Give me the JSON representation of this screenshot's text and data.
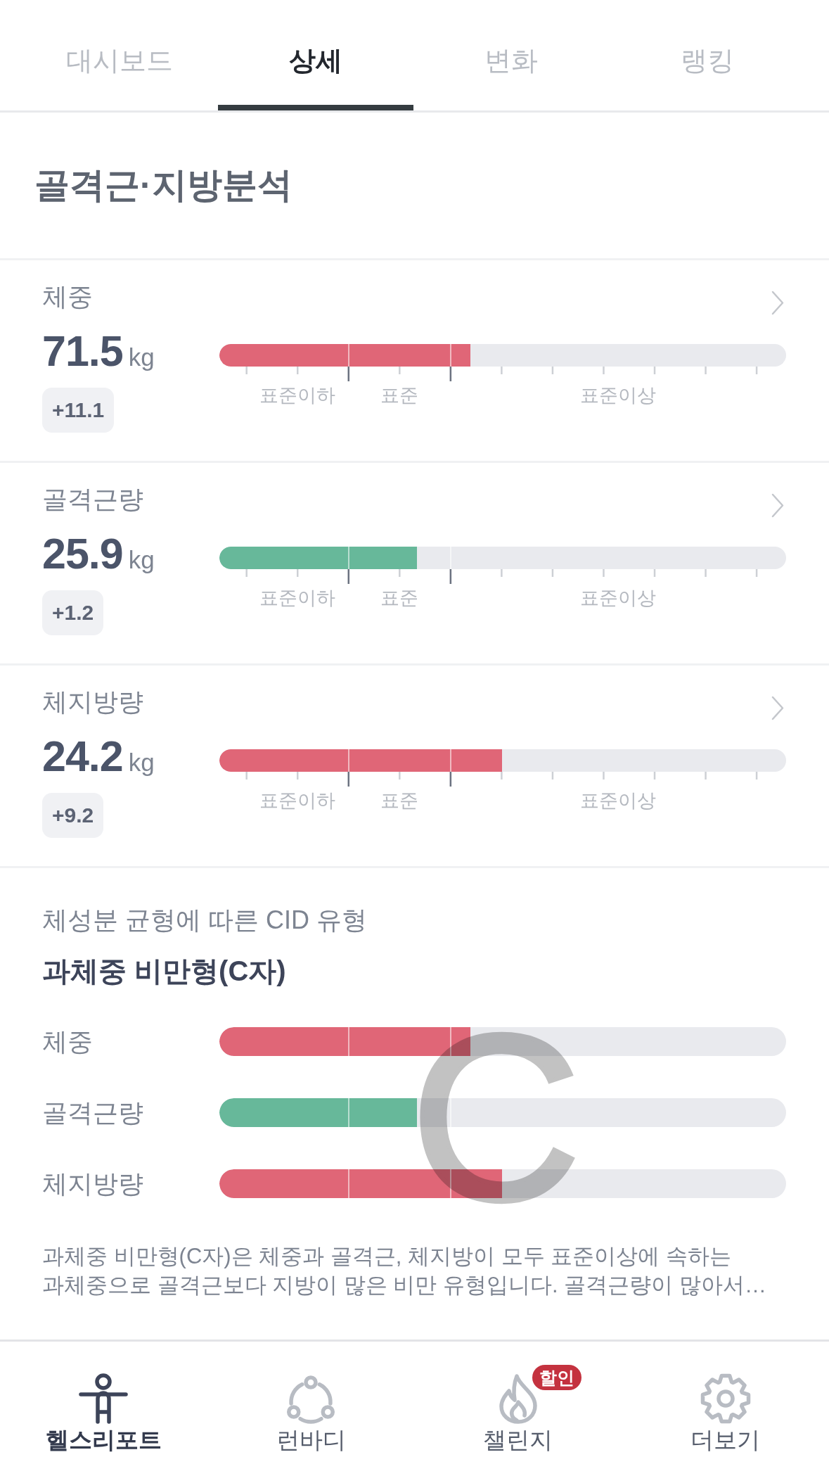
{
  "tabs": [
    {
      "label": "대시보드",
      "selected": false
    },
    {
      "label": "상세",
      "selected": true
    },
    {
      "label": "변화",
      "selected": false
    },
    {
      "label": "랭킹",
      "selected": false
    }
  ],
  "section_title": "골격근·지방분석",
  "metrics": [
    {
      "name": "체중",
      "value": "71.5",
      "unit": "kg",
      "change": "+11.1",
      "level": 0.443,
      "color": "#e06677",
      "range_labels": [
        "표준이하",
        "표준",
        "표준이상"
      ]
    },
    {
      "name": "골격근량",
      "value": "25.9",
      "unit": "kg",
      "change": "+1.2",
      "level": 0.349,
      "color": "#67b89a",
      "range_labels": [
        "표준이하",
        "표준",
        "표준이상"
      ]
    },
    {
      "name": "체지방량",
      "value": "24.2",
      "unit": "kg",
      "change": "+9.2",
      "level": 0.499,
      "color": "#e06677",
      "range_labels": [
        "표준이하",
        "표준",
        "표준이상"
      ]
    }
  ],
  "cid": {
    "caption": "체성분 균형에 따른 CID 유형",
    "type_name": "과체중 비만형(C자)",
    "type_letter": "C",
    "bars": [
      {
        "name": "체중",
        "level": 0.443,
        "color": "#e06677"
      },
      {
        "name": "골격근량",
        "level": 0.349,
        "color": "#67b89a"
      },
      {
        "name": "체지방량",
        "level": 0.499,
        "color": "#e06677"
      }
    ],
    "description": "과체중 비만형(C자)은 체중과 골격근, 체지방이 모두 표준이상에 속하는 과체중으로 골격근보다 지방이 많은 비만 유형입니다. 골격근량이 많아서…"
  },
  "bottom_nav": [
    {
      "label": "헬스리포트",
      "selected": true
    },
    {
      "label": "런바디",
      "selected": false
    },
    {
      "label": "챌린지",
      "selected": false,
      "badge": "할인"
    },
    {
      "label": "더보기",
      "selected": false
    }
  ]
}
